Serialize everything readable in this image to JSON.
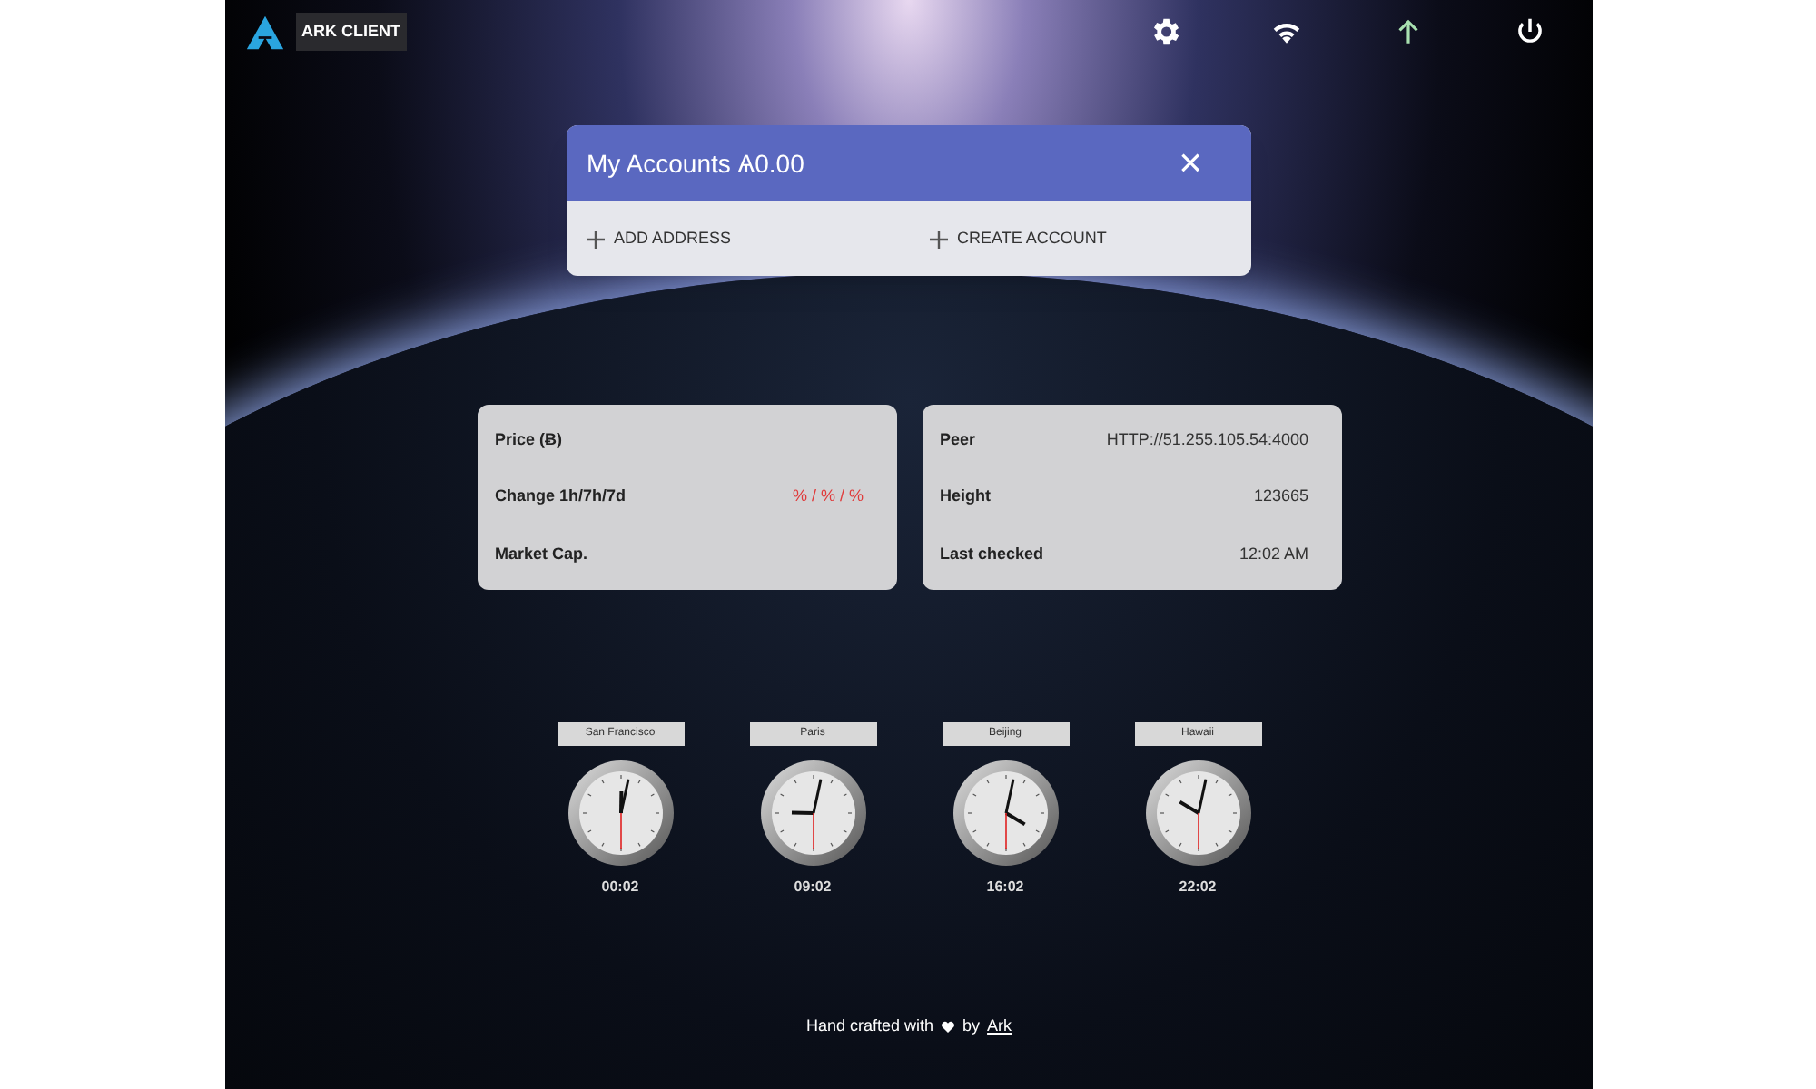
{
  "header": {
    "app_name": "ARK CLIENT",
    "upload_active": true
  },
  "accounts": {
    "title": "My Accounts Ѧ0.00",
    "close": "×",
    "actions": [
      "ADD ADDRESS",
      "CREATE ACCOUNT"
    ]
  },
  "market": [
    {
      "label": "Price (Ƀ)",
      "kind": "plain"
    },
    {
      "label": "Change 1h/7h/7d",
      "value": "% / % / %",
      "kind": "change"
    },
    {
      "label": "Market Cap.",
      "kind": "plain"
    }
  ],
  "network": [
    {
      "label": "Peer",
      "value": "HTTP://51.255.105.54:4000"
    },
    {
      "label": "Height",
      "value": "123665"
    },
    {
      "label": "Last checked",
      "value": "12:02 AM"
    }
  ],
  "clocks": [
    {
      "city": "San Francisco",
      "time": "00:02"
    },
    {
      "city": "Paris",
      "time": "09:02"
    },
    {
      "city": "Beijing",
      "time": "16:02"
    },
    {
      "city": "Hawaii",
      "time": "22:02"
    }
  ],
  "footer": {
    "before": "Hand crafted with",
    "after": "by",
    "link": "Ark"
  }
}
